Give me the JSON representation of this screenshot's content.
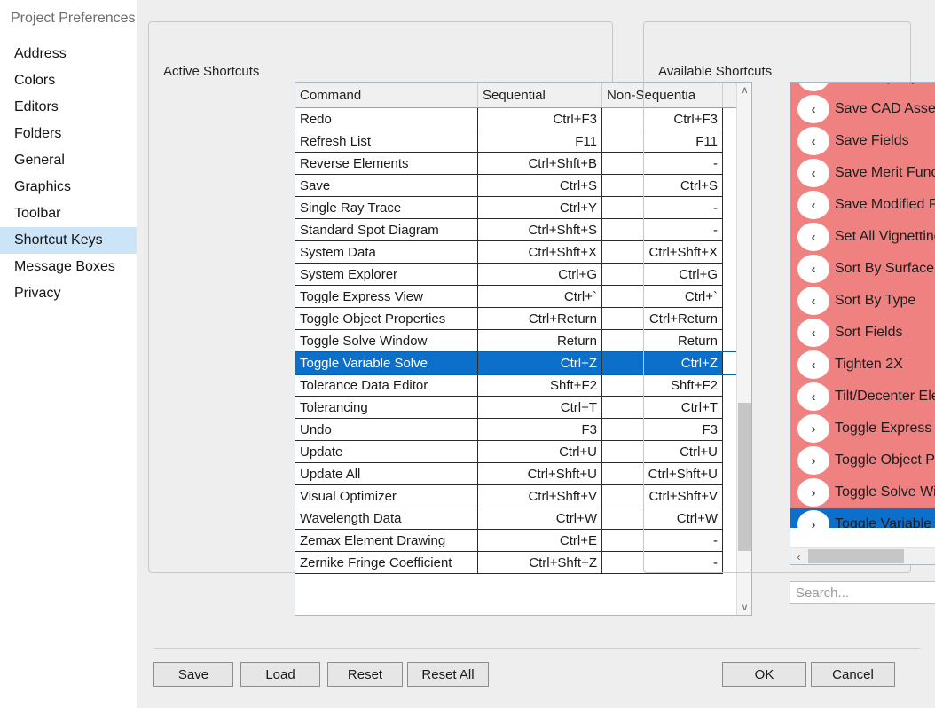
{
  "window": {
    "title": "Project Preferences"
  },
  "sidebar": {
    "items": [
      {
        "label": "Address",
        "selected": false
      },
      {
        "label": "Colors",
        "selected": false
      },
      {
        "label": "Editors",
        "selected": false
      },
      {
        "label": "Folders",
        "selected": false
      },
      {
        "label": "General",
        "selected": false
      },
      {
        "label": "Graphics",
        "selected": false
      },
      {
        "label": "Toolbar",
        "selected": false
      },
      {
        "label": "Shortcut Keys",
        "selected": true
      },
      {
        "label": "Message Boxes",
        "selected": false
      },
      {
        "label": "Privacy",
        "selected": false
      }
    ]
  },
  "active_shortcuts": {
    "legend": "Active Shortcuts",
    "columns": [
      "Command",
      "Sequential",
      "Non-Sequentia"
    ],
    "rows": [
      {
        "command": "Redo",
        "sequential": "Ctrl+F3",
        "non_sequential": "Ctrl+F3",
        "selected": false
      },
      {
        "command": "Refresh List",
        "sequential": "F11",
        "non_sequential": "F11",
        "selected": false
      },
      {
        "command": "Reverse Elements",
        "sequential": "Ctrl+Shft+B",
        "non_sequential": "-",
        "selected": false
      },
      {
        "command": "Save",
        "sequential": "Ctrl+S",
        "non_sequential": "Ctrl+S",
        "selected": false
      },
      {
        "command": "Single Ray Trace",
        "sequential": "Ctrl+Y",
        "non_sequential": "-",
        "selected": false
      },
      {
        "command": "Standard Spot Diagram",
        "sequential": "Ctrl+Shft+S",
        "non_sequential": "-",
        "selected": false
      },
      {
        "command": "System Data",
        "sequential": "Ctrl+Shft+X",
        "non_sequential": "Ctrl+Shft+X",
        "selected": false
      },
      {
        "command": "System Explorer",
        "sequential": "Ctrl+G",
        "non_sequential": "Ctrl+G",
        "selected": false
      },
      {
        "command": "Toggle Express View",
        "sequential": "Ctrl+`",
        "non_sequential": "Ctrl+`",
        "selected": false
      },
      {
        "command": "Toggle Object Properties",
        "sequential": "Ctrl+Return",
        "non_sequential": "Ctrl+Return",
        "selected": false
      },
      {
        "command": "Toggle Solve Window",
        "sequential": "Return",
        "non_sequential": "Return",
        "selected": false
      },
      {
        "command": "Toggle Variable Solve",
        "sequential": "Ctrl+Z",
        "non_sequential": "Ctrl+Z",
        "selected": true
      },
      {
        "command": "Tolerance Data Editor",
        "sequential": "Shft+F2",
        "non_sequential": "Shft+F2",
        "selected": false
      },
      {
        "command": "Tolerancing",
        "sequential": "Ctrl+T",
        "non_sequential": "Ctrl+T",
        "selected": false
      },
      {
        "command": "Undo",
        "sequential": "F3",
        "non_sequential": "F3",
        "selected": false
      },
      {
        "command": "Update",
        "sequential": "Ctrl+U",
        "non_sequential": "Ctrl+U",
        "selected": false
      },
      {
        "command": "Update All",
        "sequential": "Ctrl+Shft+U",
        "non_sequential": "Ctrl+Shft+U",
        "selected": false
      },
      {
        "command": "Visual Optimizer",
        "sequential": "Ctrl+Shft+V",
        "non_sequential": "Ctrl+Shft+V",
        "selected": false
      },
      {
        "command": "Wavelength Data",
        "sequential": "Ctrl+W",
        "non_sequential": "Ctrl+W",
        "selected": false
      },
      {
        "command": "Zemax Element Drawing",
        "sequential": "Ctrl+E",
        "non_sequential": "-",
        "selected": false
      },
      {
        "command": "Zernike Fringe Coefficient",
        "sequential": "Ctrl+Shft+Z",
        "non_sequential": "-",
        "selected": false
      }
    ]
  },
  "available_shortcuts": {
    "legend": "Available Shortcuts",
    "items": [
      {
        "label": "Roadway Lighting Wizard",
        "chevron": "‹",
        "selected": false,
        "clipped_top": true
      },
      {
        "label": "Save CAD Assembly/Part",
        "chevron": "‹",
        "selected": false
      },
      {
        "label": "Save Fields",
        "chevron": "‹",
        "selected": false
      },
      {
        "label": "Save Merit Function",
        "chevron": "‹",
        "selected": false
      },
      {
        "label": "Save Modified Part",
        "chevron": "‹",
        "selected": false
      },
      {
        "label": "Set All Vignetting",
        "chevron": "‹",
        "selected": false
      },
      {
        "label": "Sort By Surface",
        "chevron": "‹",
        "selected": false
      },
      {
        "label": "Sort By Type",
        "chevron": "‹",
        "selected": false
      },
      {
        "label": "Sort Fields",
        "chevron": "‹",
        "selected": false
      },
      {
        "label": "Tighten 2X",
        "chevron": "‹",
        "selected": false
      },
      {
        "label": "Tilt/Decenter Elements",
        "chevron": "‹",
        "selected": false
      },
      {
        "label": "Toggle Express View",
        "chevron": "›",
        "selected": false
      },
      {
        "label": "Toggle Object Properties",
        "chevron": "›",
        "selected": false
      },
      {
        "label": "Toggle Solve Window",
        "chevron": "›",
        "selected": false
      },
      {
        "label": "Toggle Variable Solve",
        "chevron": "›",
        "selected": true
      }
    ],
    "scroll_left_arrow": "‹",
    "scroll_right_arrow": "›",
    "scroll_up_arrow": "∧",
    "scroll_down_arrow": "∨"
  },
  "search": {
    "value": "",
    "placeholder": "Search..."
  },
  "footer": {
    "save": "Save",
    "load": "Load",
    "reset": "Reset",
    "reset_all": "Reset All",
    "ok": "OK",
    "cancel": "Cancel",
    "help": "?"
  },
  "colors": {
    "selection_blue": "#0c6fc9",
    "list_pink": "#ef8181",
    "nav_selected": "#cce4f7",
    "workspace_bg": "#eeeeee"
  }
}
